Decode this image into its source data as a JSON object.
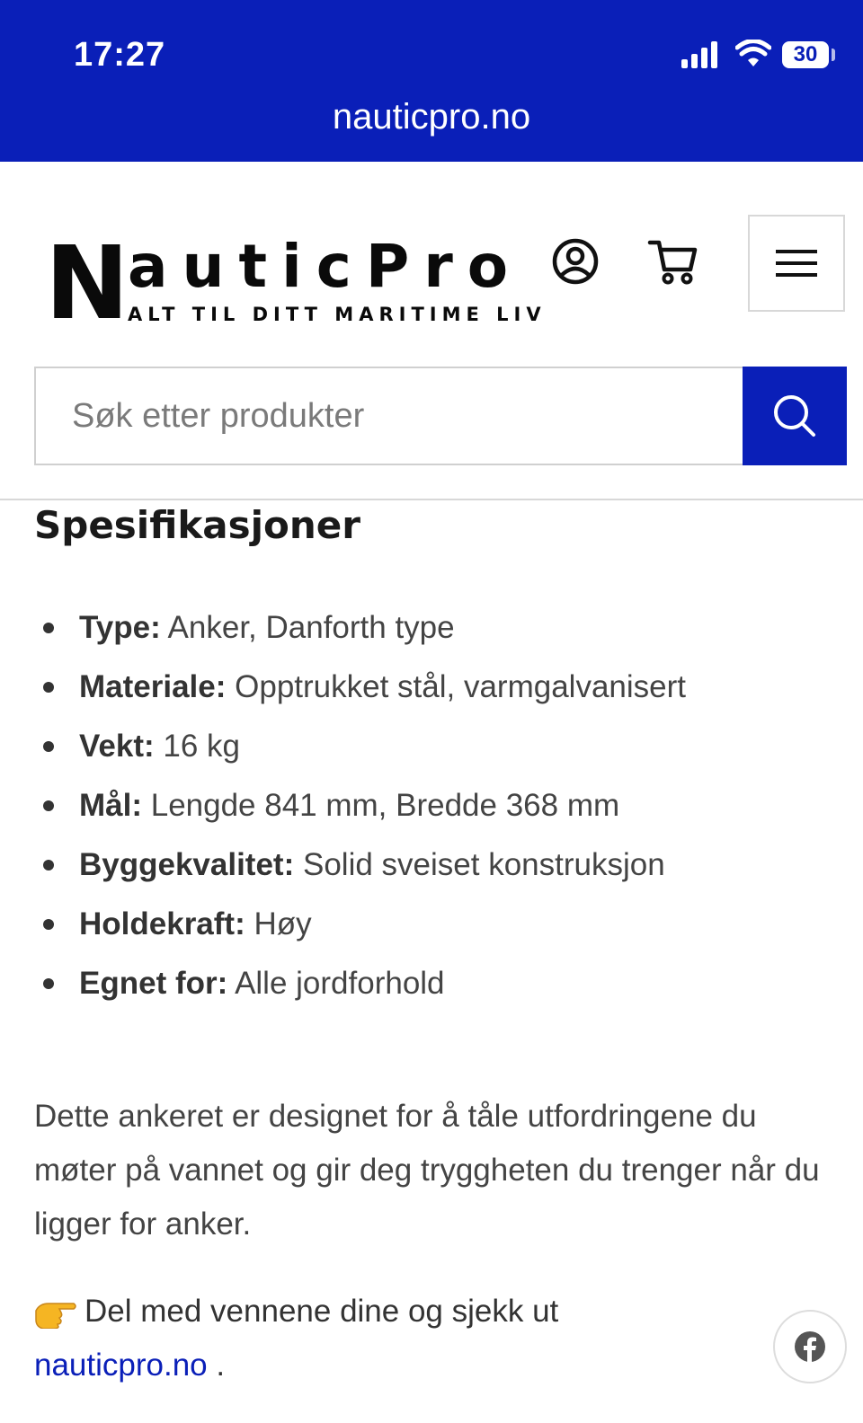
{
  "status_bar": {
    "time": "17:27",
    "battery": "30",
    "url": "nauticpro.no"
  },
  "header": {
    "logo_first": "N",
    "logo_rest": "auticPro",
    "logo_tagline": "ALT TIL DITT MARITIME LIV"
  },
  "search": {
    "placeholder": "Søk etter produkter"
  },
  "specs": {
    "title": "Spesifikasjoner",
    "items": [
      {
        "key": "Type:",
        "value": "Anker, Danforth type"
      },
      {
        "key": "Materiale:",
        "value": "Opptrukket stål, varmgalvanisert"
      },
      {
        "key": "Vekt:",
        "value": "16 kg"
      },
      {
        "key": "Mål:",
        "value": "Lengde 841 mm, Bredde 368 mm"
      },
      {
        "key": "Byggekvalitet:",
        "value": "Solid sveiset konstruksjon"
      },
      {
        "key": "Holdekraft:",
        "value": "Høy"
      },
      {
        "key": "Egnet for:",
        "value": "Alle jordforhold"
      }
    ]
  },
  "description": "Dette ankeret er designet for å tåle utfordringene du møter på vannet og gir deg tryggheten du trenger når du ligger for anker.",
  "share": {
    "text": "Del med vennene dine og sjekk ut",
    "link": "nauticpro.no",
    "suffix": " ."
  },
  "colors": {
    "brand_blue": "#0a1fb8"
  }
}
